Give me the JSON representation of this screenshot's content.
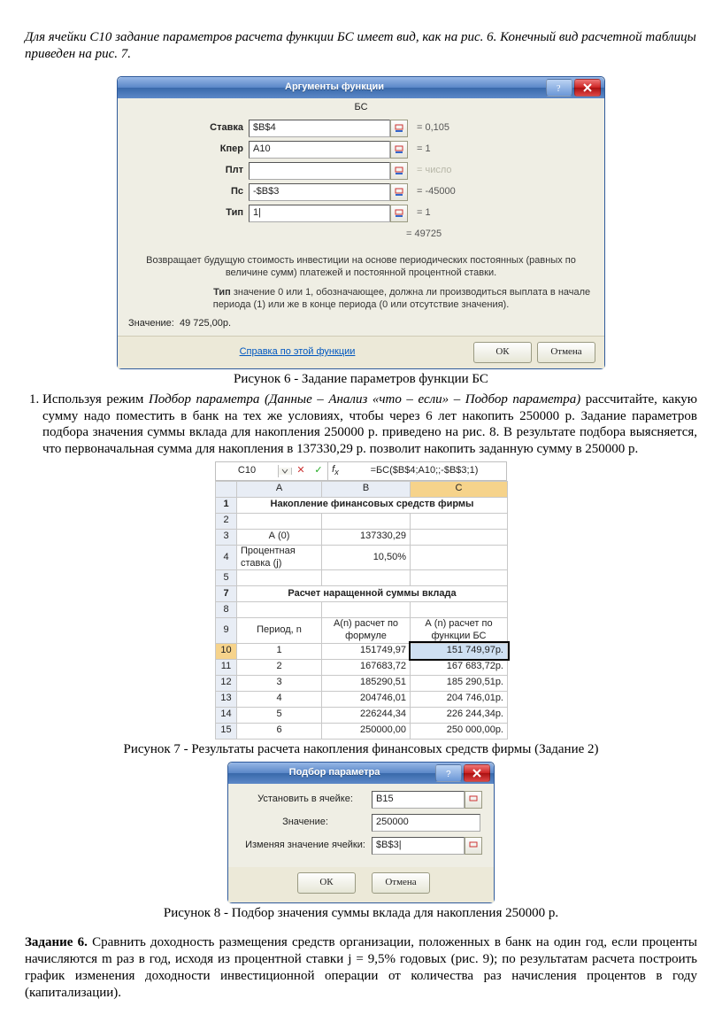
{
  "intro1": "Для ячейки С10 задание параметров расчета функции БС имеет вид, как на рис. 6. Конечный вид расчетной таблицы приведен на рис. 7.",
  "fig6": {
    "dialog_title": "Аргументы функции",
    "funcname": "БС",
    "params": [
      {
        "label": "Ставка",
        "value": "$B$4",
        "eq": "= 0,105"
      },
      {
        "label": "Кпер",
        "value": "A10",
        "eq": "= 1"
      },
      {
        "label": "Плт",
        "value": "",
        "eq": "= число"
      },
      {
        "label": "Пс",
        "value": "-$B$3",
        "eq": "= -45000"
      },
      {
        "label": "Тип",
        "value": "1|",
        "eq": "= 1"
      }
    ],
    "result_eq": "= 49725",
    "desc1": "Возвращает будущую стоимость инвестиции на основе периодических постоянных (равных по величине сумм) платежей и постоянной процентной ставки.",
    "desc_tip_lbl": "Тип",
    "desc_tip": "значение 0 или 1, обозначающее, должна ли производиться выплата в начале периода (1) или же в конце периода (0 или отсутствие значения).",
    "value_label": "Значение:",
    "value": "49 725,00р.",
    "help_link": "Справка по этой функции",
    "ok": "ОК",
    "cancel": "Отмена"
  },
  "caption6": "Рисунок 6 - Задание параметров функции БС",
  "task1": {
    "pre": "Используя режим ",
    "em1": "Подбор параметра (Данные – Анализ «что – если» – Подбор параметра)",
    "post": " рассчитайте, какую сумму надо поместить в банк на тех же условиях, чтобы через 6 лет накопить 250000 р. Задание параметров подбора значения суммы вклада для накопления 250000 р. приведено на рис. 8. В результате подбора выясняется, что первоначальная сумма для накопления в 137330,29 р. позволит накопить заданную сумму в 250000 р."
  },
  "excel": {
    "namebox": "C10",
    "formula": "=БС($B$4;A10;;-$B$3;1)",
    "colA": "A",
    "colB": "B",
    "colC": "C",
    "rows": {
      "1": {
        "A": "Накопление финансовых средств фирмы",
        "merged": true
      },
      "2": {
        "A": "",
        "B": "",
        "C": ""
      },
      "3": {
        "A": "А (0)",
        "B": "137330,29",
        "C": ""
      },
      "4": {
        "A": "Процентная ставка (j)",
        "B": "10,50%",
        "C": ""
      },
      "5": {
        "A": "",
        "B": "",
        "C": ""
      },
      "7": {
        "A": "Расчет наращенной суммы вклада",
        "merged": true
      },
      "8": {
        "A": "",
        "B": "",
        "C": ""
      },
      "9": {
        "A": "Период, n",
        "B": "А(n) расчет по формуле",
        "C": "А (n) расчет по функции БС"
      },
      "10": {
        "A": "1",
        "B": "151749,97",
        "C": "151 749,97р."
      },
      "11": {
        "A": "2",
        "B": "167683,72",
        "C": "167 683,72р."
      },
      "12": {
        "A": "3",
        "B": "185290,51",
        "C": "185 290,51р."
      },
      "13": {
        "A": "4",
        "B": "204746,01",
        "C": "204 746,01р."
      },
      "14": {
        "A": "5",
        "B": "226244,34",
        "C": "226 244,34р."
      },
      "15": {
        "A": "6",
        "B": "250000,00",
        "C": "250 000,00р."
      }
    }
  },
  "caption7": "Рисунок 7 - Результаты расчета накопления финансовых средств фирмы (Задание 2)",
  "gs": {
    "title": "Подбор параметра",
    "r1_label": "Установить в ячейке:",
    "r1_val": "B15",
    "r2_label": "Значение:",
    "r2_val": "250000",
    "r3_label": "Изменяя значение ячейки:",
    "r3_val": "$B$3|",
    "ok": "ОК",
    "cancel": "Отмена"
  },
  "caption8": "Рисунок 8 - Подбор значения суммы вклада для накопления 250000 р.",
  "task6_lbl": "Задание 6.",
  "task6_txt": " Сравнить доходность размещения средств организации, положенных в банк на один год, если проценты начисляются m раз в год, исходя из процентной ставки j = 9,5% годовых (рис. 9); по результатам расчета построить график изменения доходности инвестиционной операции от количества раз начисления процентов в году (капитализации)."
}
